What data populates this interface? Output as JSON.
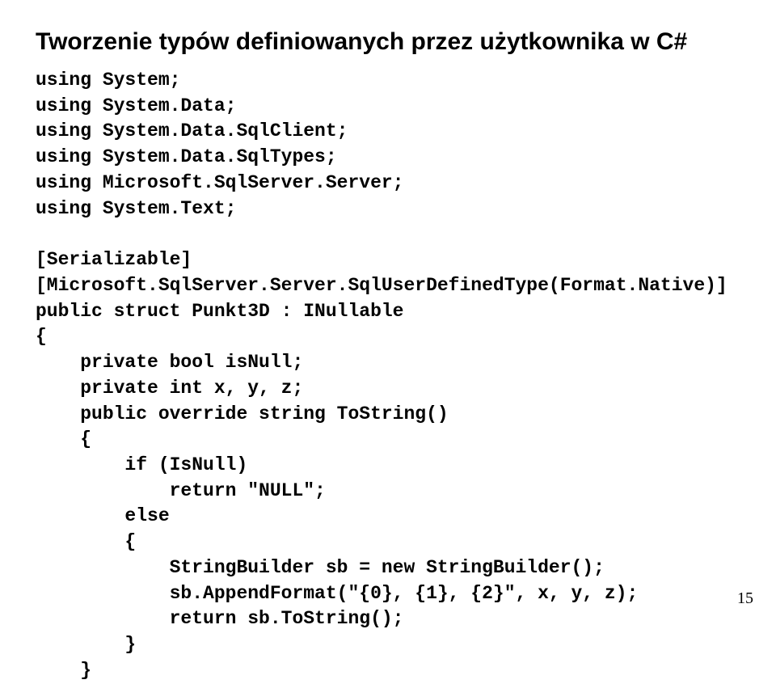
{
  "title": "Tworzenie typów definiowanych przez użytkownika w C#",
  "code": {
    "l1": "using System;",
    "l2": "using System.Data;",
    "l3": "using System.Data.SqlClient;",
    "l4": "using System.Data.SqlTypes;",
    "l5": "using Microsoft.SqlServer.Server;",
    "l6": "using System.Text;",
    "l7": "",
    "l8": "[Serializable]",
    "l9": "[Microsoft.SqlServer.Server.SqlUserDefinedType(Format.Native)]",
    "l10": "public struct Punkt3D : INullable",
    "l11": "{",
    "l12": "    private bool isNull;",
    "l13": "    private int x, y, z;",
    "l14": "    public override string ToString()",
    "l15": "    {",
    "l16": "        if (IsNull)",
    "l17": "            return \"NULL\";",
    "l18": "        else",
    "l19": "        {",
    "l20": "            StringBuilder sb = new StringBuilder();",
    "l21": "            sb.AppendFormat(\"{0}, {1}, {2}\", x, y, z);",
    "l22": "            return sb.ToString();",
    "l23": "        }",
    "l24": "    }"
  },
  "page_number": "15"
}
